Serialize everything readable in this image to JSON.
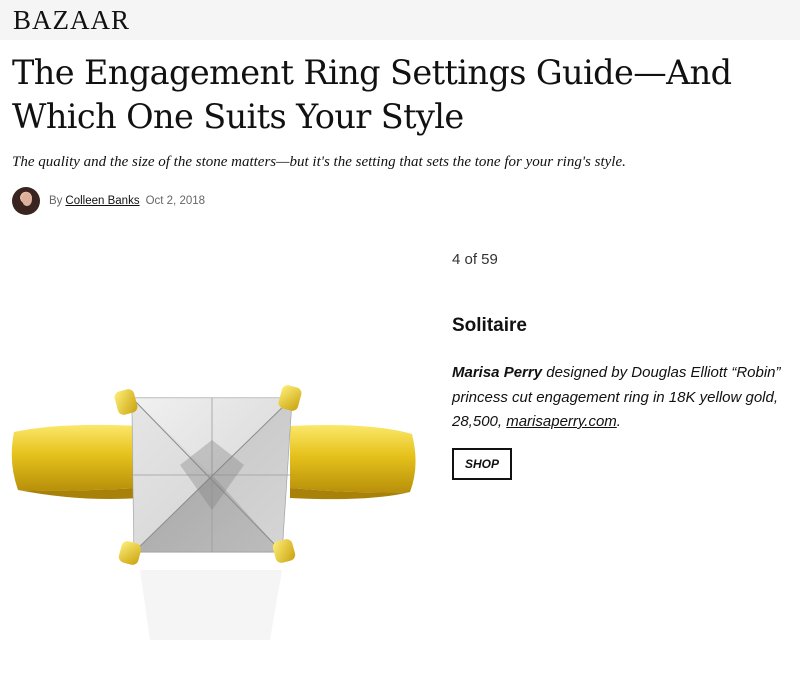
{
  "header": {
    "logo": "BAZAAR"
  },
  "article": {
    "headline": "The Engagement Ring Settings Guide—And Which One Suits Your Style",
    "dek": "The quality and the size of the stone matters—but it's the setting that sets the tone for your ring's style.",
    "byline": {
      "prefix": "By",
      "author": "Colleen Banks",
      "date": "Oct 2, 2018"
    }
  },
  "slide": {
    "counter": "4 of 59",
    "title": "Solitaire",
    "caption": {
      "brand": "Marisa Perry",
      "text": " designed by Douglas Elliott “Robin” princess cut engagement ring in 18K yellow gold, 28,500, ",
      "link": "marisaperry.com",
      "end": "."
    },
    "shop_label": "SHOP"
  },
  "colors": {
    "gold": "#e6c21c",
    "diamond": "#dcdcdc",
    "topbar": "#f5f5f5"
  }
}
